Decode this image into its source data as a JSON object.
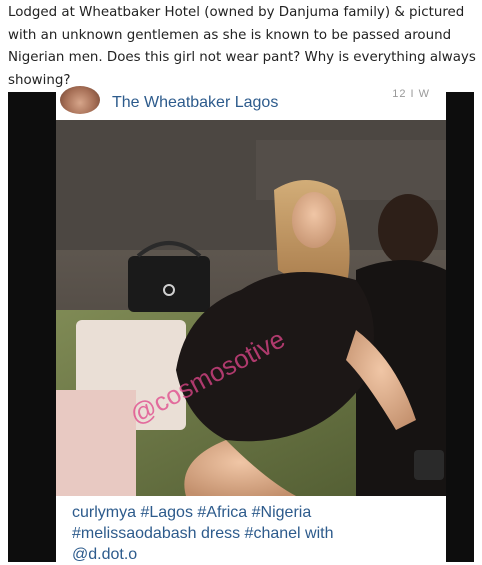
{
  "post": {
    "caption_text": "Lodged at Wheatbaker Hotel (owned by Danjuma family) & pictured with an unknown gentlemen as she is known to be passed around Nigerian men. Does this girl not wear pant? Why is everything always showing?"
  },
  "instagram": {
    "profile_name": "The Wheatbaker Lagos",
    "time_ago": "12 I W",
    "watermark": "@cosmosotive",
    "caption_line1": "curlymya #Lagos #Africa #Nigeria",
    "caption_line2": "#melissaodabash dress #chanel with",
    "caption_line3": "@d.dot.o"
  },
  "colors": {
    "link_blue": "#2d5b8c",
    "frame_black": "#0d0d0d",
    "watermark_pink": "#e0468a"
  }
}
